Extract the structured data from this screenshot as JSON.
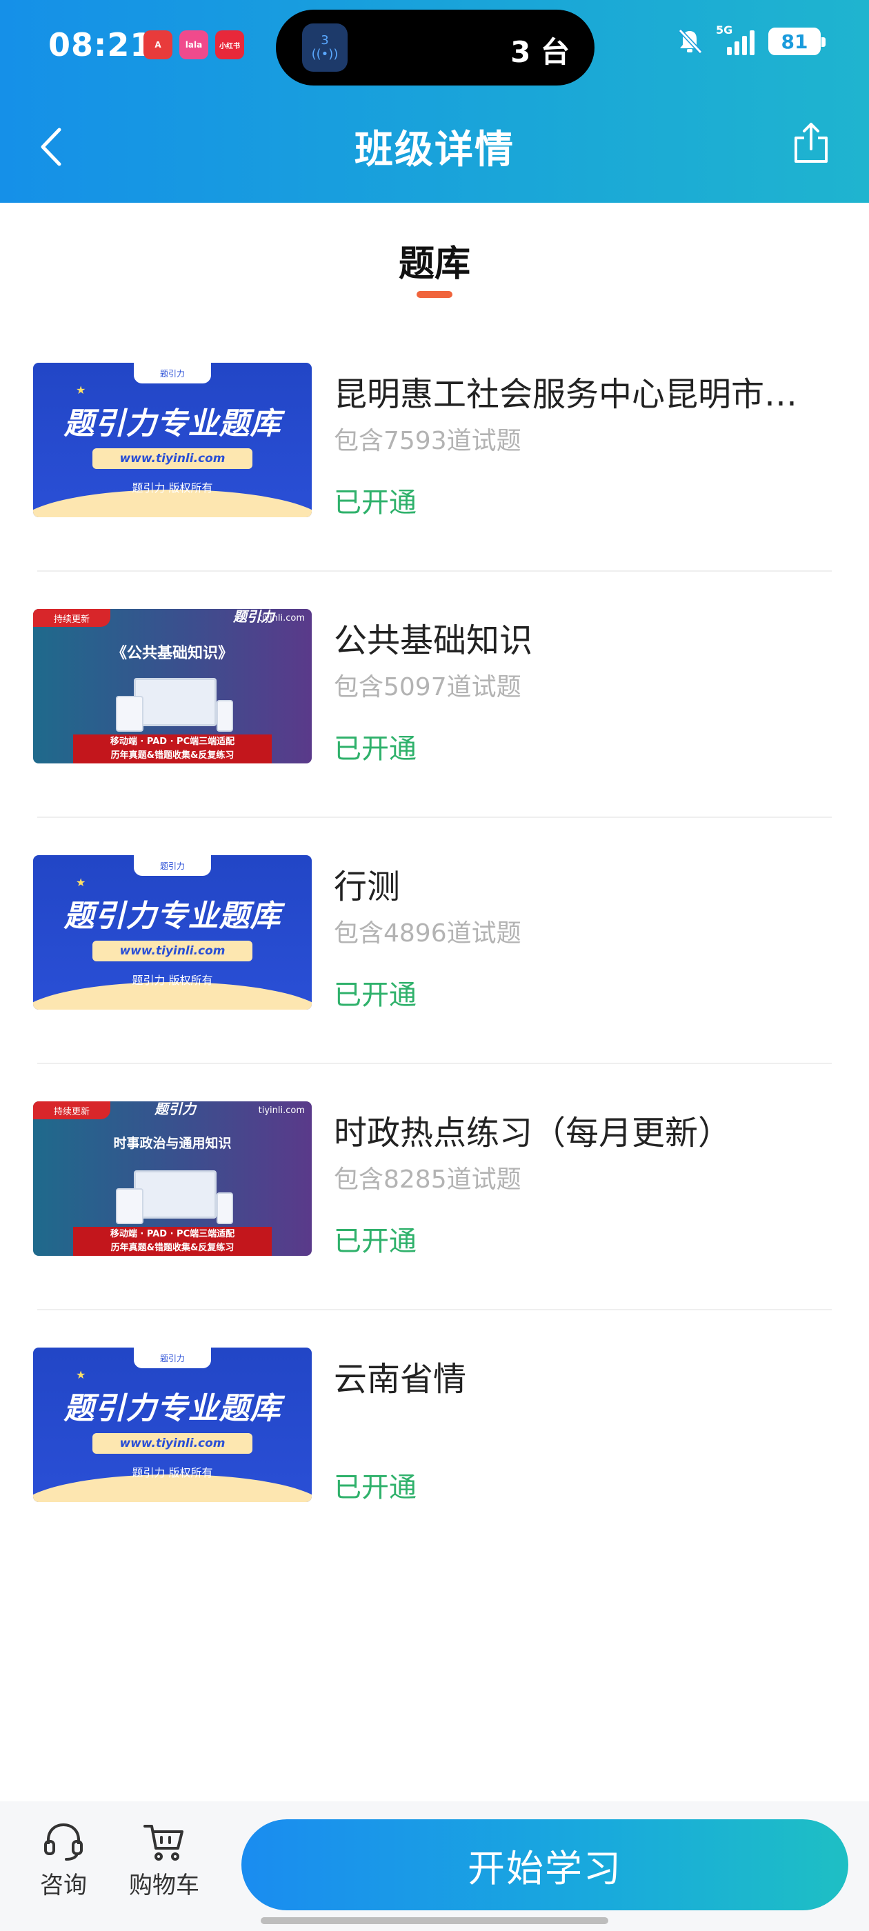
{
  "status_bar": {
    "time": "08:21",
    "app_badges": [
      {
        "icon": "app-a-icon",
        "label": "A",
        "color": "#e83b3b"
      },
      {
        "icon": "app-lala-icon",
        "label": "lala",
        "color": "#f04a8c"
      },
      {
        "icon": "xiaohongshu-icon",
        "label": "小红书",
        "color": "#e8283a"
      }
    ],
    "island_icon_number": "3",
    "island_count": "3 台",
    "network": "5G",
    "battery": "81"
  },
  "nav": {
    "title": "班级详情"
  },
  "tab": {
    "label": "题库"
  },
  "thumbs": {
    "a": {
      "tag": "题引力",
      "headline": "题引力专业题库",
      "url": "www.tiyinli.com",
      "copyright": "题引力 版权所有"
    },
    "b1": {
      "flag": "持续更新",
      "site": "tiyinli.com",
      "logo": "题引力",
      "heading": "《公共基础知识》",
      "line1": "移动端 · PAD · PC端三端适配",
      "line2": "历年真题&错题收集&反复练习"
    },
    "b2": {
      "flag": "持续更新",
      "site": "tiyinli.com",
      "logo": "题引力",
      "heading": "时事政治与通用知识",
      "line1": "移动端 · PAD · PC端三端适配",
      "line2": "历年真题&错题收集&反复练习"
    }
  },
  "items": [
    {
      "title": "昆明惠工社会服务中心昆明市…",
      "count": "包含7593道试题",
      "status": "已开通"
    },
    {
      "title": "公共基础知识",
      "count": "包含5097道试题",
      "status": "已开通"
    },
    {
      "title": "行测",
      "count": "包含4896道试题",
      "status": "已开通"
    },
    {
      "title": "时政热点练习（每月更新）",
      "count": "包含8285道试题",
      "status": "已开通"
    },
    {
      "title": "云南省情",
      "count": "",
      "status": "已开通"
    }
  ],
  "bottom_bar": {
    "consult_label": "咨询",
    "cart_label": "购物车",
    "start_label": "开始学习"
  },
  "colors": {
    "header_gradient_start": "#1590e8",
    "header_gradient_end": "#1fb4cf",
    "status_green": "#2fb16b",
    "tab_underline": "#f0643c"
  }
}
